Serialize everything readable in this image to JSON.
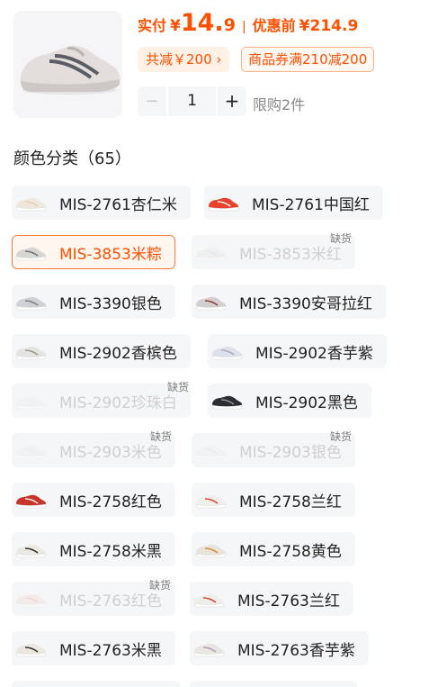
{
  "product": {
    "current_price_label": "实付",
    "currency": "¥",
    "current_price_int": "14.",
    "current_price_dec": "9",
    "separator": "|",
    "original_price_label": "优惠前",
    "original_price": "¥214.9",
    "save_chip": "共减￥200 ›",
    "coupon_chip": "商品券满210减200"
  },
  "quantity": {
    "minus": "−",
    "value": "1",
    "plus": "+",
    "limit_text": "限购2件"
  },
  "colors": {
    "title": "颜色分类（65）",
    "out_of_stock_label": "缺货",
    "items": [
      {
        "label": "MIS-2761杏仁米",
        "state": "normal",
        "shoe_color": "#efe7dc",
        "accent": "#e3cdb2"
      },
      {
        "label": "MIS-2761中国红",
        "state": "normal",
        "shoe_color": "#e8412c",
        "accent": "#f2efe9"
      },
      {
        "label": "MIS-3853米粽",
        "state": "selected",
        "shoe_color": "#d8d6d2",
        "accent": "#6b6c72"
      },
      {
        "label": "MIS-3853米红",
        "state": "out_of_stock",
        "shoe_color": "#e4e4e4",
        "accent": "#d9c9c4"
      },
      {
        "label": "MIS-3390银色",
        "state": "normal",
        "shoe_color": "#cfd1d4",
        "accent": "#7b7e84"
      },
      {
        "label": "MIS-3390安哥拉红",
        "state": "normal",
        "shoe_color": "#d2d0ce",
        "accent": "#8d3c3c"
      },
      {
        "label": "MIS-2902香槟色",
        "state": "normal",
        "shoe_color": "#e5e3df",
        "accent": "#9c9891"
      },
      {
        "label": "MIS-2902香芋紫",
        "state": "normal",
        "shoe_color": "#dfe1ea",
        "accent": "#a3a8c8"
      },
      {
        "label": "MIS-2902珍珠白",
        "state": "out_of_stock",
        "shoe_color": "#ececec",
        "accent": "#dedede"
      },
      {
        "label": "MIS-2902黑色",
        "state": "normal",
        "shoe_color": "#2b2d33",
        "accent": "#8e9098"
      },
      {
        "label": "MIS-2903米色",
        "state": "out_of_stock",
        "shoe_color": "#ececec",
        "accent": "#dedede"
      },
      {
        "label": "MIS-2903银色",
        "state": "out_of_stock",
        "shoe_color": "#ececec",
        "accent": "#d6d6d6"
      },
      {
        "label": "MIS-2758红色",
        "state": "normal",
        "shoe_color": "#c7342a",
        "accent": "#f1ece3"
      },
      {
        "label": "MIS-2758兰红",
        "state": "normal",
        "shoe_color": "#f1efe9",
        "accent": "#d9463a"
      },
      {
        "label": "MIS-2758米黑",
        "state": "normal",
        "shoe_color": "#ece9e2",
        "accent": "#2d2d2d"
      },
      {
        "label": "MIS-2758黄色",
        "state": "normal",
        "shoe_color": "#e8e4dc",
        "accent": "#d58a3b"
      },
      {
        "label": "MIS-2763红色",
        "state": "out_of_stock",
        "shoe_color": "#f2d8d2",
        "accent": "#e59a8c"
      },
      {
        "label": "MIS-2763兰红",
        "state": "normal",
        "shoe_color": "#efede8",
        "accent": "#c9473f"
      },
      {
        "label": "MIS-2763米黑",
        "state": "normal",
        "shoe_color": "#ebe7df",
        "accent": "#333333"
      },
      {
        "label": "MIS-2763香芋紫",
        "state": "normal",
        "shoe_color": "#e9e6e1",
        "accent": "#a9a0b8"
      }
    ]
  },
  "theme": {
    "accent": "#ff5000",
    "chip_bg": "#f5f6f8",
    "disabled_text": "#cfcfcf"
  }
}
